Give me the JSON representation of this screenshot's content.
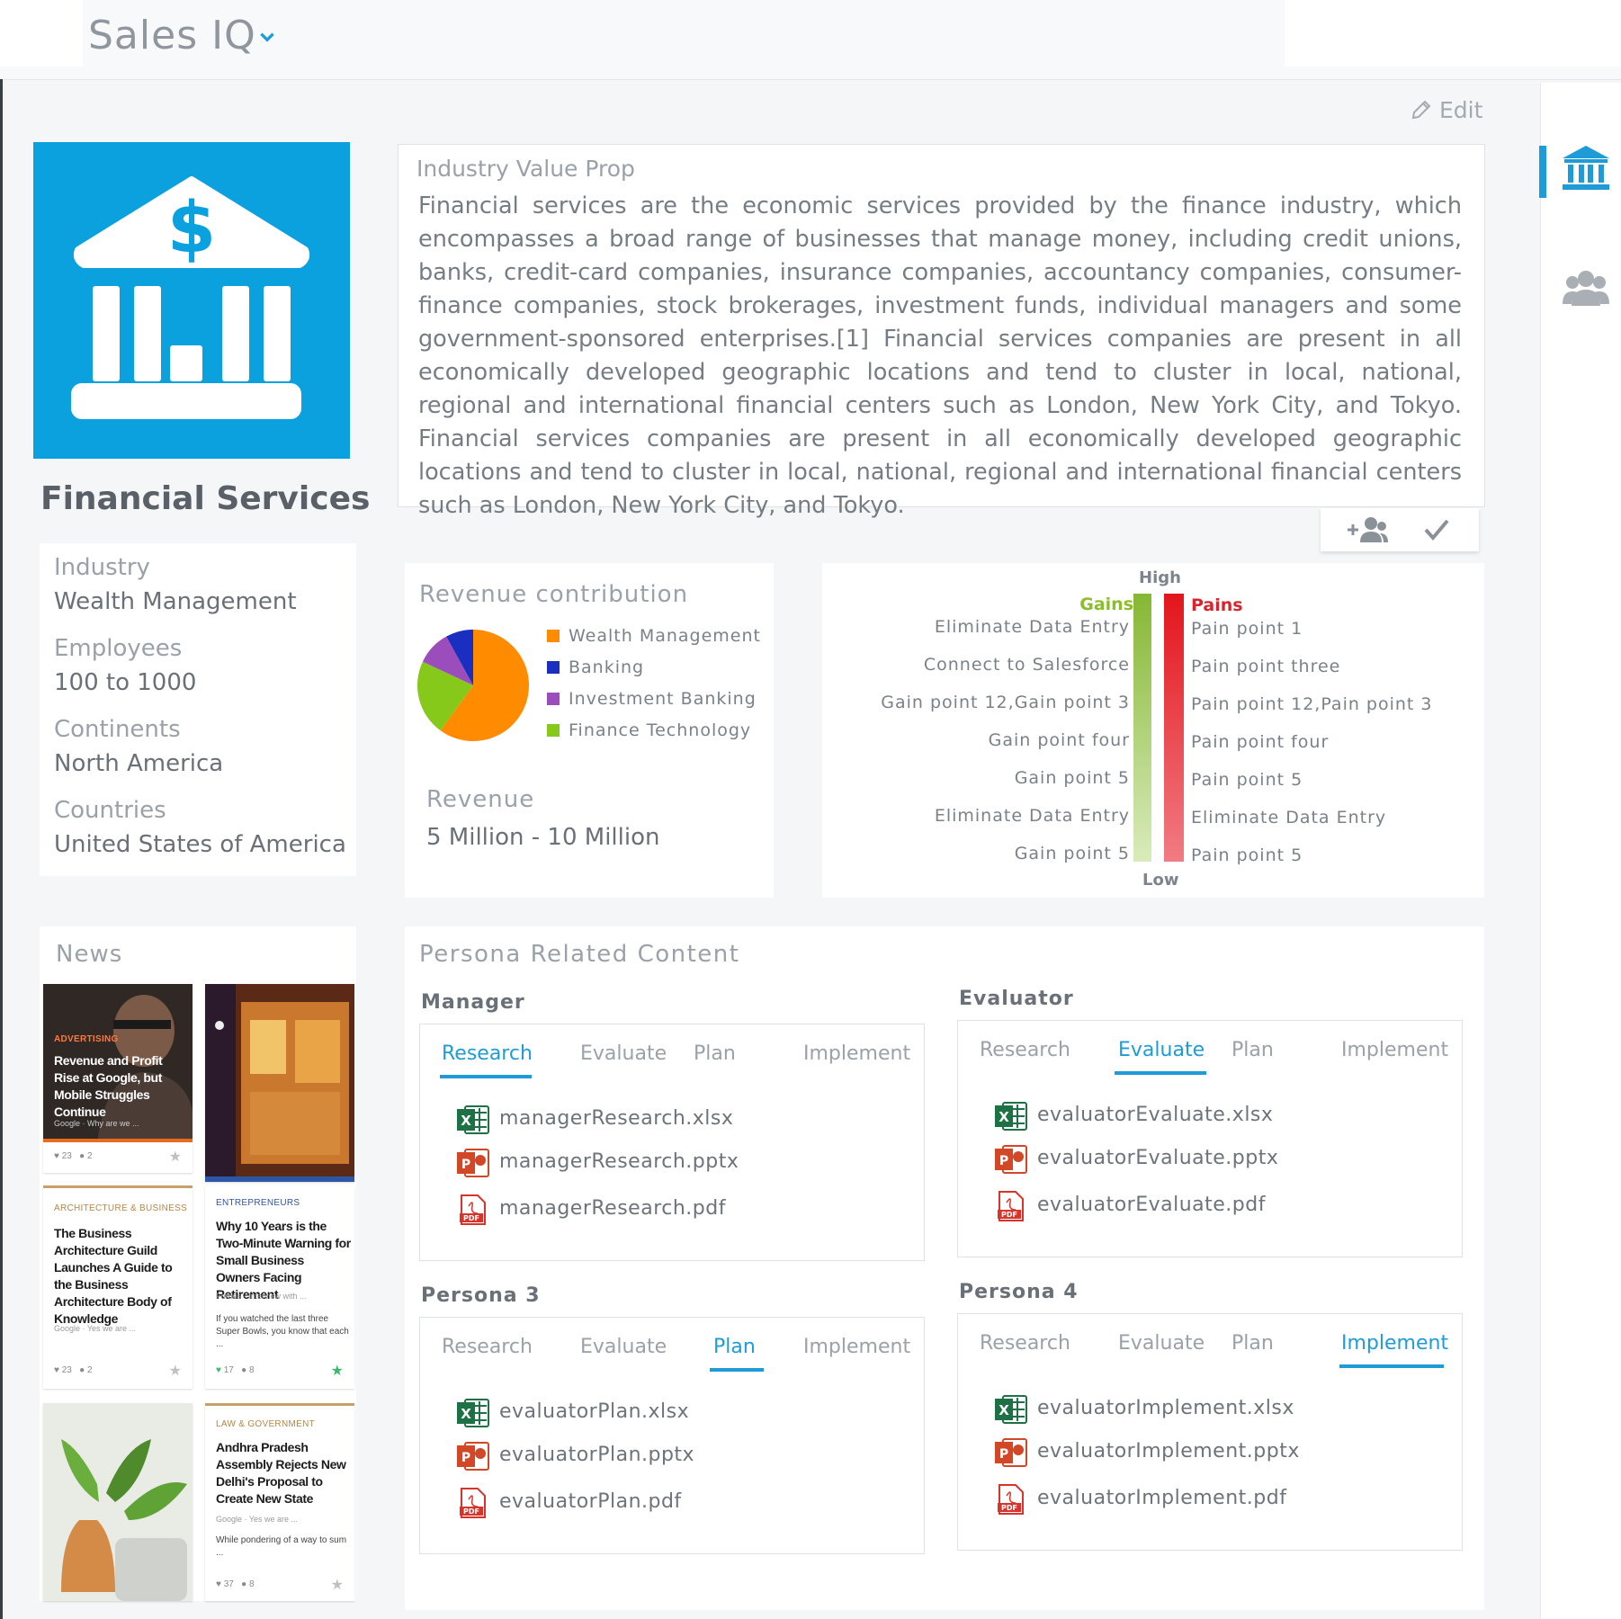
{
  "header": {
    "app_title": "Sales IQ"
  },
  "toolbar": {
    "edit_label": "Edit"
  },
  "industry": {
    "name": "Financial Services",
    "props": [
      {
        "label": "Industry",
        "value": "Wealth Management"
      },
      {
        "label": "Employees",
        "value": "100 to 1000"
      },
      {
        "label": "Continents",
        "value": "North America"
      },
      {
        "label": "Countries",
        "value": "United States of America"
      }
    ]
  },
  "value_prop": {
    "title": "Industry Value Prop",
    "text": "Financial services are the economic services provided by the finance industry, which encompasses a broad range of businesses that manage money, including credit unions, banks, credit-card companies, insurance companies, accountancy companies, consumer-finance companies, stock brokerages, investment funds, individual managers and some government-sponsored enterprises.[1] Financial services companies are present in all economically developed geographic locations and tend to cluster in local, national, regional and international financial centers such as London, New York City, and Tokyo. Financial services companies are present in all economically developed geographic locations and tend to cluster in local, national, regional and international financial centers such as London, New York City, and Tokyo."
  },
  "revenue": {
    "title": "Revenue contribution",
    "legend": [
      {
        "name": "Wealth Management",
        "color": "#ff8c00",
        "share": 0.6
      },
      {
        "name": "Banking",
        "color": "#1a2fbf",
        "share": 0.08
      },
      {
        "name": "Investment Banking",
        "color": "#9b4dbb",
        "share": 0.1
      },
      {
        "name": "Finance Technology",
        "color": "#86c91a",
        "share": 0.22
      }
    ],
    "revenue_label": "Revenue",
    "revenue_value": "5 Million - 10 Million"
  },
  "gains_pains": {
    "high_label": "High",
    "low_label": "Low",
    "gains_label": "Gains",
    "pains_label": "Pains",
    "gains": [
      "Eliminate Data Entry",
      "Connect to Salesforce",
      "Gain point 12,Gain point 3",
      "Gain point four",
      "Gain point 5",
      "Eliminate Data Entry",
      "Gain point 5"
    ],
    "pains": [
      "Pain point 1",
      "Pain point three",
      "Pain point 12,Pain point 3",
      "Pain point four",
      "Pain point 5",
      "Eliminate Data Entry",
      "Pain point 5"
    ],
    "gain_color": "#86b733",
    "pain_color": "#e3151c"
  },
  "news": {
    "title": "News",
    "items": [
      {
        "category": "ADVERTISING",
        "headline": "Revenue and Profit Rise at Google, but Mobile Struggles Continue",
        "source": "Google · Why are we ...",
        "likes": "23",
        "comments": "2"
      },
      {
        "category": "",
        "headline": "",
        "source": "",
        "likes": "",
        "comments": ""
      },
      {
        "category": "ARCHITECTURE & BUSINESS",
        "headline": "The Business Architecture Guild Launches A Guide to the Business Architecture Body of Knowledge",
        "source": "Google · Yes we are ...",
        "likes": "23",
        "comments": "2"
      },
      {
        "category": "ENTREPRENEURS",
        "headline": "Why 10 Years is the Two-Minute Warning for Small Business Owners Facing Retirement",
        "source": "Forbes · Interview with ...",
        "excerpt": "If you watched the last three Super Bowls, you know that each ...",
        "likes": "17",
        "comments": "8"
      },
      {
        "category": "",
        "headline": "",
        "source": "",
        "likes": "",
        "comments": ""
      },
      {
        "category": "LAW & GOVERNMENT",
        "headline": "Andhra Pradesh Assembly Rejects New Delhi's Proposal to Create New State",
        "source": "Google · Yes we are ...",
        "excerpt": "While pondering of a way to sum ...",
        "likes": "37",
        "comments": "8"
      }
    ]
  },
  "persona_content": {
    "title": "Persona Related Content",
    "tabs": [
      "Research",
      "Evaluate",
      "Plan",
      "Implement"
    ],
    "personas": [
      {
        "name": "Manager",
        "active_tab": 0,
        "files": [
          "managerResearch.xlsx",
          "managerResearch.pptx",
          "managerResearch.pdf"
        ]
      },
      {
        "name": "Evaluator",
        "active_tab": 1,
        "files": [
          "evaluatorEvaluate.xlsx",
          "evaluatorEvaluate.pptx",
          "evaluatorEvaluate.pdf"
        ]
      },
      {
        "name": "Persona 3",
        "active_tab": 2,
        "files": [
          "evaluatorPlan.xlsx",
          "evaluatorPlan.pptx",
          "evaluatorPlan.pdf"
        ]
      },
      {
        "name": "Persona 4",
        "active_tab": 3,
        "files": [
          "evaluatorImplement.xlsx",
          "evaluatorImplement.pptx",
          "evaluatorImplement.pdf"
        ]
      }
    ]
  },
  "icons": {
    "bank": "bank-icon",
    "people": "people-icon",
    "add_user": "add-user-icon",
    "check": "check-icon",
    "pencil": "pencil-icon",
    "excel": "excel-icon",
    "powerpoint": "powerpoint-icon",
    "pdf": "pdf-icon"
  },
  "colors": {
    "accent": "#1f9bd7",
    "tile_bg": "#0ba1df"
  }
}
